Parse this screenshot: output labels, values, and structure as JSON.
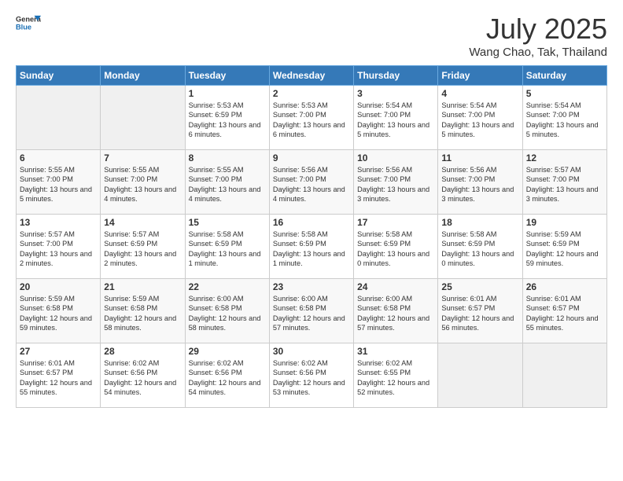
{
  "header": {
    "logo_line1": "General",
    "logo_line2": "Blue",
    "month": "July 2025",
    "location": "Wang Chao, Tak, Thailand"
  },
  "weekdays": [
    "Sunday",
    "Monday",
    "Tuesday",
    "Wednesday",
    "Thursday",
    "Friday",
    "Saturday"
  ],
  "weeks": [
    [
      {
        "day": "",
        "empty": true
      },
      {
        "day": "",
        "empty": true
      },
      {
        "day": "1",
        "sunrise": "Sunrise: 5:53 AM",
        "sunset": "Sunset: 6:59 PM",
        "daylight": "Daylight: 13 hours and 6 minutes."
      },
      {
        "day": "2",
        "sunrise": "Sunrise: 5:53 AM",
        "sunset": "Sunset: 7:00 PM",
        "daylight": "Daylight: 13 hours and 6 minutes."
      },
      {
        "day": "3",
        "sunrise": "Sunrise: 5:54 AM",
        "sunset": "Sunset: 7:00 PM",
        "daylight": "Daylight: 13 hours and 5 minutes."
      },
      {
        "day": "4",
        "sunrise": "Sunrise: 5:54 AM",
        "sunset": "Sunset: 7:00 PM",
        "daylight": "Daylight: 13 hours and 5 minutes."
      },
      {
        "day": "5",
        "sunrise": "Sunrise: 5:54 AM",
        "sunset": "Sunset: 7:00 PM",
        "daylight": "Daylight: 13 hours and 5 minutes."
      }
    ],
    [
      {
        "day": "6",
        "sunrise": "Sunrise: 5:55 AM",
        "sunset": "Sunset: 7:00 PM",
        "daylight": "Daylight: 13 hours and 5 minutes."
      },
      {
        "day": "7",
        "sunrise": "Sunrise: 5:55 AM",
        "sunset": "Sunset: 7:00 PM",
        "daylight": "Daylight: 13 hours and 4 minutes."
      },
      {
        "day": "8",
        "sunrise": "Sunrise: 5:55 AM",
        "sunset": "Sunset: 7:00 PM",
        "daylight": "Daylight: 13 hours and 4 minutes."
      },
      {
        "day": "9",
        "sunrise": "Sunrise: 5:56 AM",
        "sunset": "Sunset: 7:00 PM",
        "daylight": "Daylight: 13 hours and 4 minutes."
      },
      {
        "day": "10",
        "sunrise": "Sunrise: 5:56 AM",
        "sunset": "Sunset: 7:00 PM",
        "daylight": "Daylight: 13 hours and 3 minutes."
      },
      {
        "day": "11",
        "sunrise": "Sunrise: 5:56 AM",
        "sunset": "Sunset: 7:00 PM",
        "daylight": "Daylight: 13 hours and 3 minutes."
      },
      {
        "day": "12",
        "sunrise": "Sunrise: 5:57 AM",
        "sunset": "Sunset: 7:00 PM",
        "daylight": "Daylight: 13 hours and 3 minutes."
      }
    ],
    [
      {
        "day": "13",
        "sunrise": "Sunrise: 5:57 AM",
        "sunset": "Sunset: 7:00 PM",
        "daylight": "Daylight: 13 hours and 2 minutes."
      },
      {
        "day": "14",
        "sunrise": "Sunrise: 5:57 AM",
        "sunset": "Sunset: 6:59 PM",
        "daylight": "Daylight: 13 hours and 2 minutes."
      },
      {
        "day": "15",
        "sunrise": "Sunrise: 5:58 AM",
        "sunset": "Sunset: 6:59 PM",
        "daylight": "Daylight: 13 hours and 1 minute."
      },
      {
        "day": "16",
        "sunrise": "Sunrise: 5:58 AM",
        "sunset": "Sunset: 6:59 PM",
        "daylight": "Daylight: 13 hours and 1 minute."
      },
      {
        "day": "17",
        "sunrise": "Sunrise: 5:58 AM",
        "sunset": "Sunset: 6:59 PM",
        "daylight": "Daylight: 13 hours and 0 minutes."
      },
      {
        "day": "18",
        "sunrise": "Sunrise: 5:58 AM",
        "sunset": "Sunset: 6:59 PM",
        "daylight": "Daylight: 13 hours and 0 minutes."
      },
      {
        "day": "19",
        "sunrise": "Sunrise: 5:59 AM",
        "sunset": "Sunset: 6:59 PM",
        "daylight": "Daylight: 12 hours and 59 minutes."
      }
    ],
    [
      {
        "day": "20",
        "sunrise": "Sunrise: 5:59 AM",
        "sunset": "Sunset: 6:58 PM",
        "daylight": "Daylight: 12 hours and 59 minutes."
      },
      {
        "day": "21",
        "sunrise": "Sunrise: 5:59 AM",
        "sunset": "Sunset: 6:58 PM",
        "daylight": "Daylight: 12 hours and 58 minutes."
      },
      {
        "day": "22",
        "sunrise": "Sunrise: 6:00 AM",
        "sunset": "Sunset: 6:58 PM",
        "daylight": "Daylight: 12 hours and 58 minutes."
      },
      {
        "day": "23",
        "sunrise": "Sunrise: 6:00 AM",
        "sunset": "Sunset: 6:58 PM",
        "daylight": "Daylight: 12 hours and 57 minutes."
      },
      {
        "day": "24",
        "sunrise": "Sunrise: 6:00 AM",
        "sunset": "Sunset: 6:58 PM",
        "daylight": "Daylight: 12 hours and 57 minutes."
      },
      {
        "day": "25",
        "sunrise": "Sunrise: 6:01 AM",
        "sunset": "Sunset: 6:57 PM",
        "daylight": "Daylight: 12 hours and 56 minutes."
      },
      {
        "day": "26",
        "sunrise": "Sunrise: 6:01 AM",
        "sunset": "Sunset: 6:57 PM",
        "daylight": "Daylight: 12 hours and 55 minutes."
      }
    ],
    [
      {
        "day": "27",
        "sunrise": "Sunrise: 6:01 AM",
        "sunset": "Sunset: 6:57 PM",
        "daylight": "Daylight: 12 hours and 55 minutes."
      },
      {
        "day": "28",
        "sunrise": "Sunrise: 6:02 AM",
        "sunset": "Sunset: 6:56 PM",
        "daylight": "Daylight: 12 hours and 54 minutes."
      },
      {
        "day": "29",
        "sunrise": "Sunrise: 6:02 AM",
        "sunset": "Sunset: 6:56 PM",
        "daylight": "Daylight: 12 hours and 54 minutes."
      },
      {
        "day": "30",
        "sunrise": "Sunrise: 6:02 AM",
        "sunset": "Sunset: 6:56 PM",
        "daylight": "Daylight: 12 hours and 53 minutes."
      },
      {
        "day": "31",
        "sunrise": "Sunrise: 6:02 AM",
        "sunset": "Sunset: 6:55 PM",
        "daylight": "Daylight: 12 hours and 52 minutes."
      },
      {
        "day": "",
        "empty": true
      },
      {
        "day": "",
        "empty": true
      }
    ]
  ]
}
